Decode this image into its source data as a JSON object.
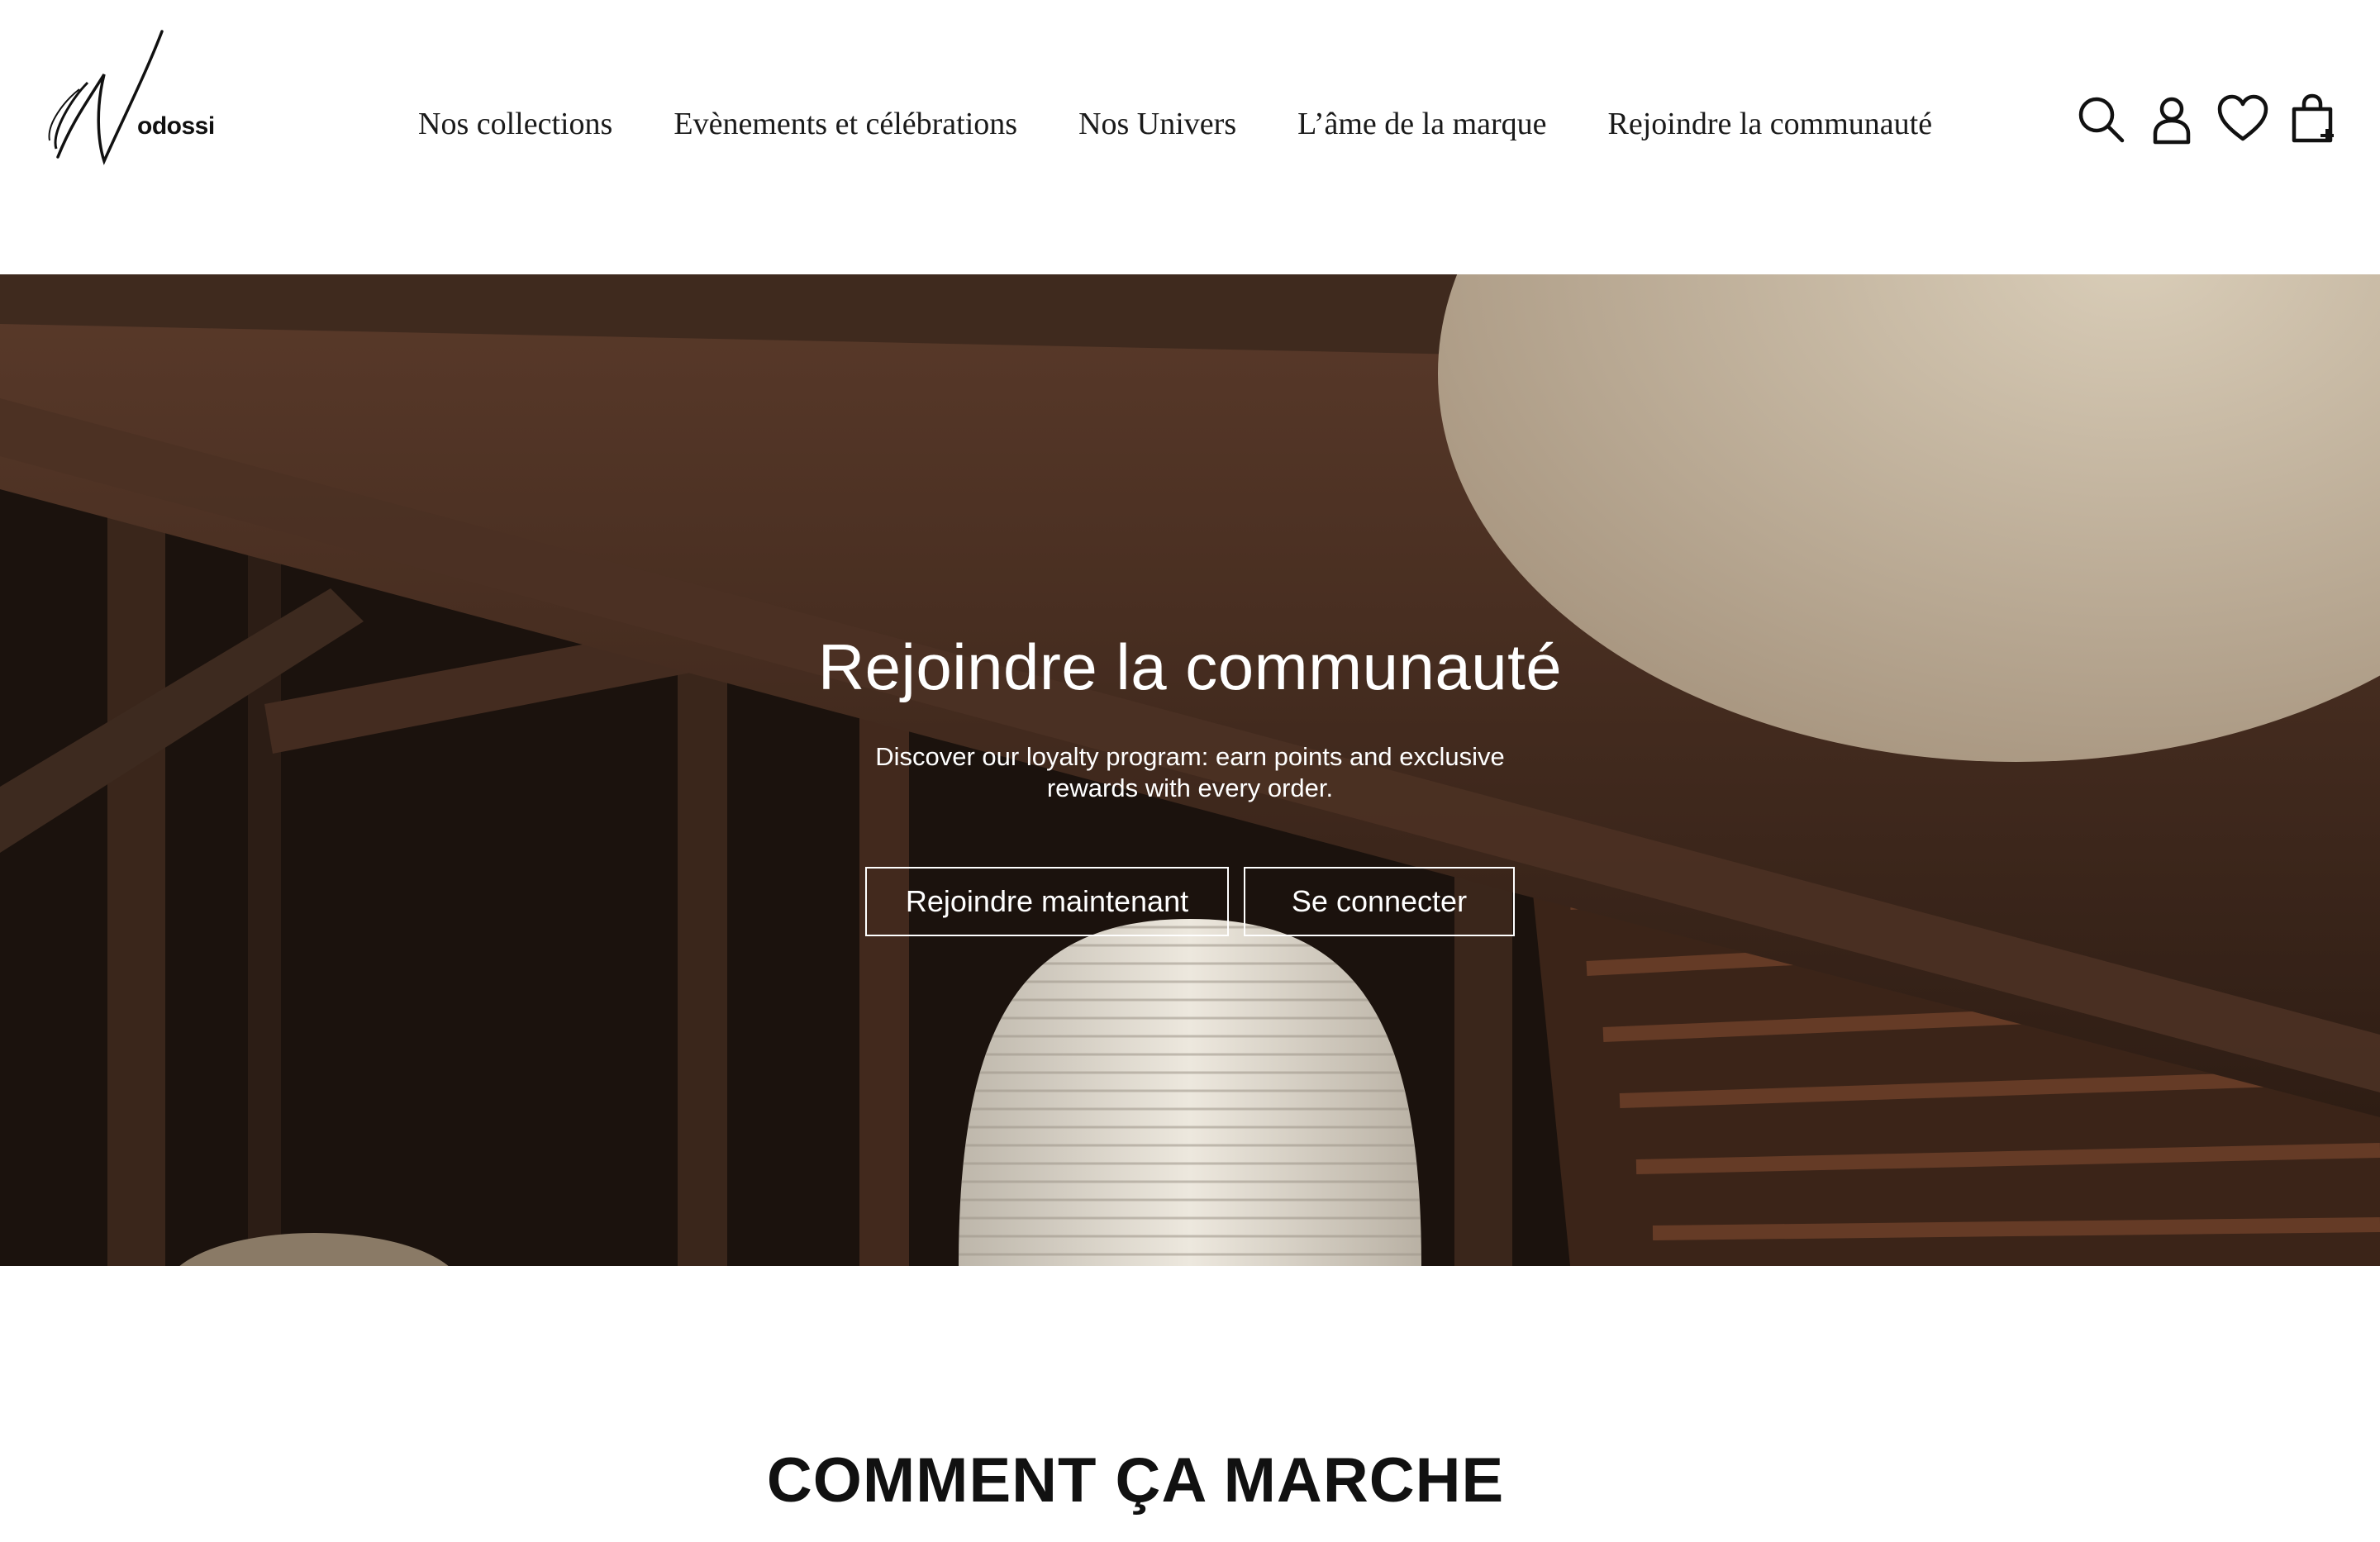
{
  "brand": {
    "name": "odossi"
  },
  "nav": {
    "items": [
      {
        "label": "Nos collections"
      },
      {
        "label": "Evènements et célébrations"
      },
      {
        "label": "Nos Univers"
      },
      {
        "label": "L’âme de la marque"
      },
      {
        "label": "Rejoindre la communauté"
      }
    ]
  },
  "header_icons": [
    "search-icon",
    "user-icon",
    "heart-icon",
    "shopping-bag-icon"
  ],
  "hero": {
    "title": "Rejoindre la communauté",
    "text": "Discover our loyalty program: earn points and exclusive rewards with every order.",
    "buttons": {
      "join": "Rejoindre maintenant",
      "login": "Se connecter"
    }
  },
  "section": {
    "title": "COMMENT ÇA MARCHE"
  },
  "colors": {
    "background": "#ffffff",
    "text": "#111111",
    "hero_overlay_text": "#ffffff",
    "hero_wood_dark": "#1c120d",
    "hero_wood": "#4a2f22",
    "lamp": "#e9e4da"
  }
}
